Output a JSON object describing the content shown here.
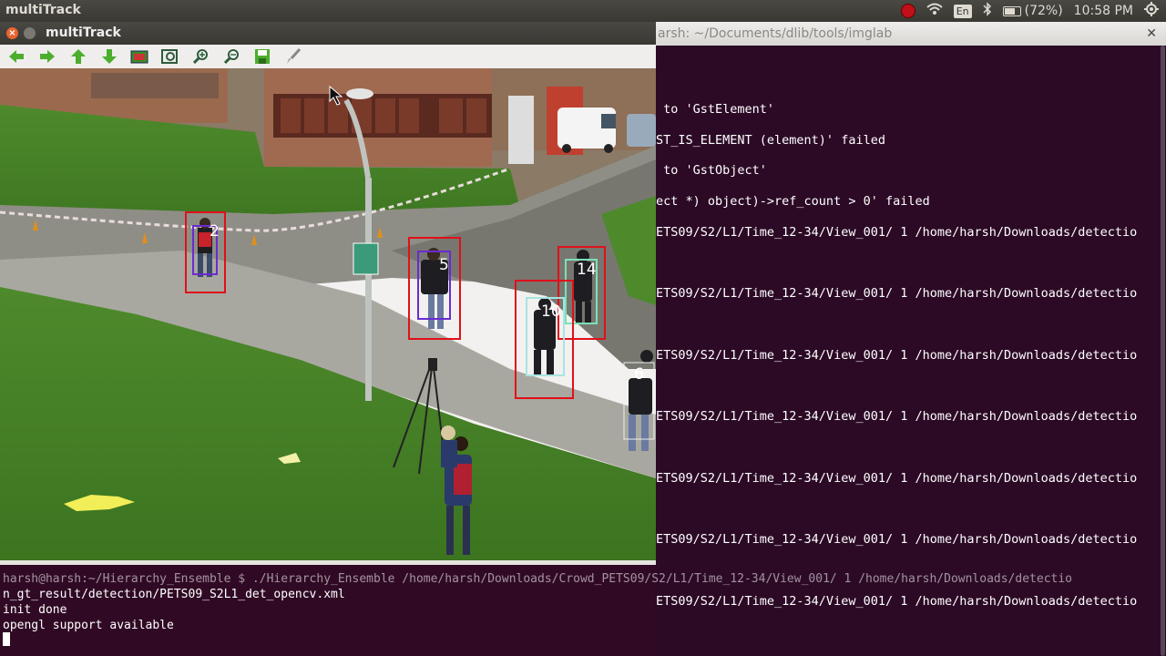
{
  "topbar": {
    "app_name": "multiTrack",
    "battery": "(72%)",
    "time": "10:58 PM",
    "keyboard": "En"
  },
  "window": {
    "title": "multiTrack",
    "toolbar": [
      "back-arrow",
      "forward-arrow",
      "up-arrow",
      "down-arrow",
      "image",
      "zoom-fit",
      "zoom-in",
      "zoom-out",
      "save",
      "brush"
    ]
  },
  "tracks": [
    {
      "id": "2",
      "color": "#6a2bd0"
    },
    {
      "id": "5",
      "color": "#6a2bd0"
    },
    {
      "id": "14",
      "color": "#7ce0b8"
    },
    {
      "id": "10",
      "color": "#a8e4e0"
    },
    {
      "id": "6",
      "color": "#eeeeee"
    }
  ],
  "terminal_right": {
    "title": "arsh: ~/Documents/dlib/tools/imglab",
    "lines": [
      " to 'GstElement'",
      "ST_IS_ELEMENT (element)' failed",
      " to 'GstObject'",
      "ect *) object)->ref_count > 0' failed",
      "ETS09/S2/L1/Time_12-34/View_001/ 1 /home/harsh/Downloads/detectio",
      "",
      "ETS09/S2/L1/Time_12-34/View_001/ 1 /home/harsh/Downloads/detectio",
      "",
      "ETS09/S2/L1/Time_12-34/View_001/ 1 /home/harsh/Downloads/detectio",
      "",
      "ETS09/S2/L1/Time_12-34/View_001/ 1 /home/harsh/Downloads/detectio",
      "",
      "ETS09/S2/L1/Time_12-34/View_001/ 1 /home/harsh/Downloads/detectio",
      "",
      "ETS09/S2/L1/Time_12-34/View_001/ 1 /home/harsh/Downloads/detectio",
      "",
      "ETS09/S2/L1/Time_12-34/View_001/ 1 /home/harsh/Downloads/detectio"
    ]
  },
  "terminal_bottom": {
    "prompt": "harsh@harsh:~/Hierarchy_Ensemble $ ./Hierarchy_Ensemble /home/harsh/Downloads/Crowd_PETS09/S2/L1/Time_12-34/View_001/ 1 /home/harsh/Downloads/detectio",
    "line2": "n_gt_result/detection/PETS09_S2L1_det_opencv.xml",
    "line3": "init done",
    "line4": "opengl support available"
  }
}
